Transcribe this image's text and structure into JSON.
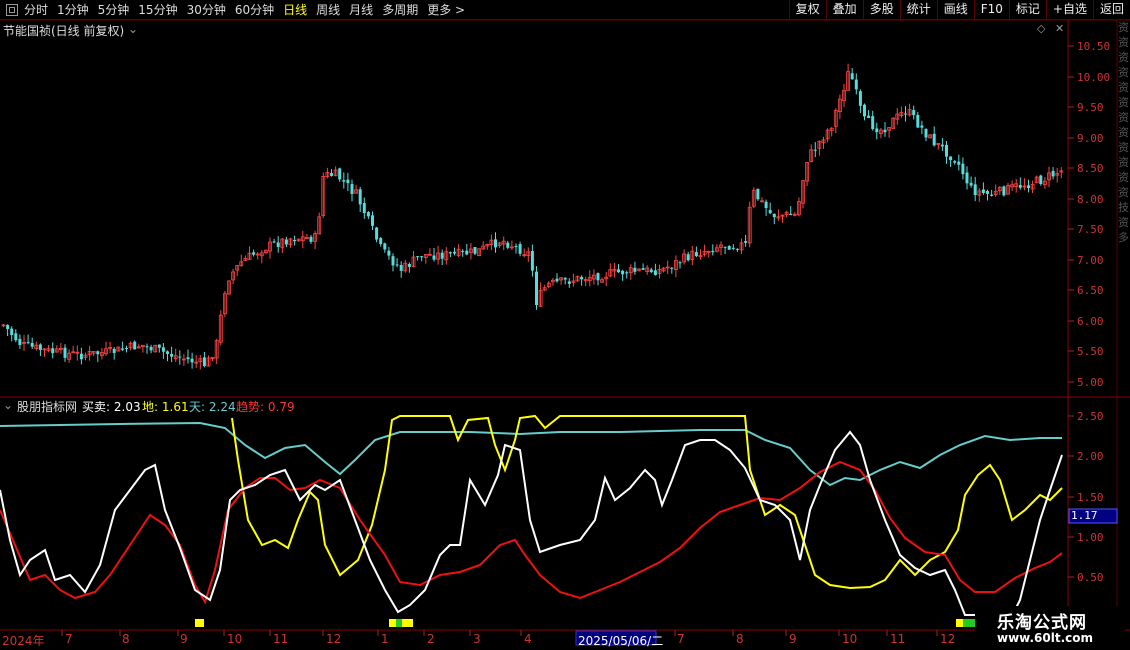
{
  "toolbar": {
    "tabs": [
      "分时",
      "1分钟",
      "5分钟",
      "15分钟",
      "30分钟",
      "60分钟",
      "日线",
      "周线",
      "月线",
      "多周期",
      "更多 >"
    ],
    "active_tab": "日线",
    "right_buttons": [
      "复权",
      "叠加",
      "多股",
      "统计",
      "画线",
      "F10",
      "标记",
      "+自选",
      "返回"
    ]
  },
  "main_panel": {
    "title": "节能国祯(日线 前复权)",
    "price_ticks": [
      "10.50",
      "10.00",
      "9.50",
      "9.00",
      "8.50",
      "8.00",
      "7.50",
      "7.00",
      "6.50",
      "6.00",
      "5.50",
      "5.00"
    ]
  },
  "indicator_panel": {
    "name": "股朋指标网",
    "values": [
      {
        "label": "买卖:",
        "value": "2.03",
        "color": "#ffffff"
      },
      {
        "label": "地:",
        "value": "1.61",
        "color": "#ffff00"
      },
      {
        "label": "天:",
        "value": "2.24",
        "color": "#66cccc"
      },
      {
        "label": "趋势:",
        "value": "0.79",
        "color": "#ff3333"
      }
    ],
    "ticks": [
      "2.50",
      "2.00",
      "1.50",
      "1.00",
      "0.50"
    ],
    "cursor_value": "1.17"
  },
  "date_axis": {
    "labels": [
      "2024年",
      "7",
      "8",
      "9",
      "10",
      "11",
      "12",
      "1",
      "2",
      "3",
      "4",
      "2025/05/06/二",
      "7",
      "8",
      "9",
      "10",
      "11",
      "12"
    ],
    "cursor_date": "2025/05/06/二"
  },
  "watermark": {
    "title": "乐淘公式网",
    "url": "www.60lt.com"
  },
  "side_strip": "资资资资资资资资资资资资技资多"
}
